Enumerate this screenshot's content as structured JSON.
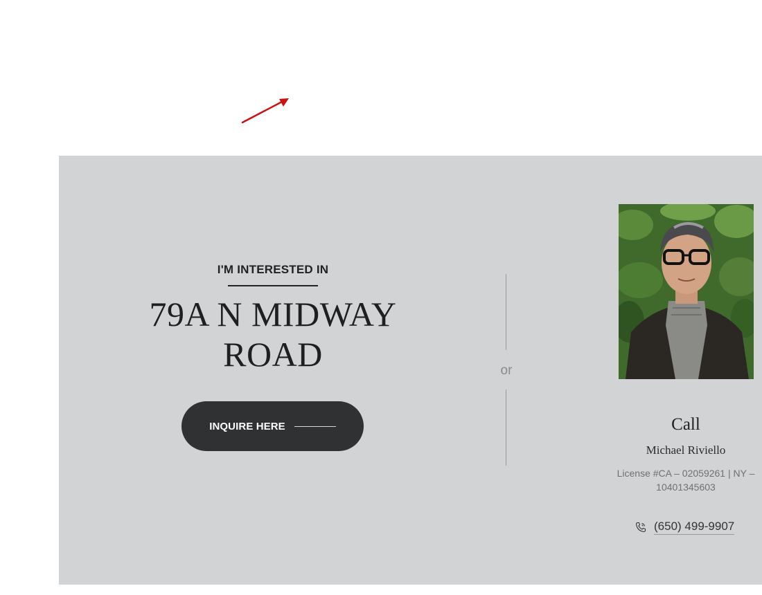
{
  "colors": {
    "panel_background": "#d2d3d5",
    "button_background": "#303133",
    "annotation_arrow": "#cc1111"
  },
  "inquiry": {
    "eyebrow": "I'M INTERESTED IN",
    "address_line1": "79A N MIDWAY",
    "address_line2": "ROAD",
    "button_label": "INQUIRE HERE"
  },
  "separator": {
    "label": "or"
  },
  "agent": {
    "photo_icon": "agent-portrait",
    "call_heading": "Call",
    "name": "Michael Riviello",
    "license_line1": "License #CA – 02059261 | NY –",
    "license_line2": "10401345603",
    "phone_icon": "phone-icon",
    "phone": "(650) 499-9907"
  },
  "annotation": {
    "icon": "red-arrow-icon"
  }
}
